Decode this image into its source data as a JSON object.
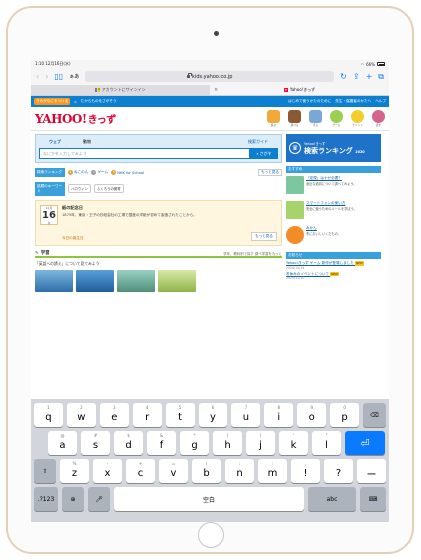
{
  "status_bar": {
    "left": "1:10  12月16日(水)",
    "right": "66%"
  },
  "browser": {
    "text_size_label": "ぁあ",
    "url": "kids.yahoo.co.jp",
    "tabs": [
      {
        "label": "アカウントにサインイン"
      },
      {
        "label": "Yahoo!きっず"
      }
    ]
  },
  "page": {
    "blue_bar": {
      "button": "きみがなにをつける",
      "links": [
        "たからものをさがそう"
      ],
      "right_links": [
        "はじめて使うかたのために",
        "先生・保護者のかたへ",
        "ヘルプ"
      ]
    },
    "logo": {
      "main": "YAHOO!",
      "sub": "きっず"
    },
    "header_icons": [
      {
        "label": "遊ぶ",
        "color": "#f2a93b"
      },
      {
        "label": "調べる",
        "color": "#8c5a32"
      },
      {
        "label": "学ぶ",
        "color": "#7aa6d8"
      },
      {
        "label": "ゲーム",
        "color": "#9bcf4f"
      },
      {
        "label": "チャット",
        "color": "#f3cf2e"
      },
      {
        "label": "話す",
        "color": "#d6638a"
      }
    ],
    "search": {
      "tabs": [
        "ウェブ",
        "動物"
      ],
      "parent_link": "検索ガイド",
      "placeholder": "なにかを入力してみよう",
      "submit": "さがす"
    },
    "ranking": {
      "label": "検索ランキング",
      "items": [
        {
          "num": "1",
          "text": "ねこのん"
        },
        {
          "num": "2",
          "text": "ゲーム"
        },
        {
          "num": "3",
          "text": "NHK for School"
        }
      ],
      "more": "もっと見る"
    },
    "keywords": {
      "label": "話題のキーワード",
      "items": [
        "ハロウィン",
        "ふくろうの飼育"
      ]
    },
    "today": {
      "month": "12月",
      "day": "16",
      "dow": "水",
      "title": "紙の記念日",
      "text": "1875年、東京・王子の抄紙会社の工場で国産の洋紙が初めて製造されたことから。",
      "birthday": "今日の誕生日",
      "more": "もっと見る"
    },
    "study": {
      "title": "学習",
      "sub": "学年、教科別で探す 調べ学習をもっと",
      "section_title": "「英語への誘え」について見てみよう"
    },
    "right": {
      "banner_small": "Yahoo!きっず",
      "banner_big": "検索ランキング",
      "banner_year": "2020",
      "section_label": "おすすめ",
      "items": [
        {
          "title": "「定規」はナゼ必要？",
          "text": "身近な道具について調べてみよう。",
          "color": "#7ec6a0"
        },
        {
          "title": "スマートフォンの使い方",
          "text": "安全に使うためのルールを学ぼう。",
          "color": "#a7d36b"
        },
        {
          "title": "みかん",
          "text": "冬においしいくだもの。",
          "color": "#f28c28"
        }
      ],
      "news_label": "お知らせ",
      "news": [
        {
          "text": "Yahoo!きっず ゲーム 新作が登場しました",
          "date": "2020/12/14"
        },
        {
          "text": "冬休みのイベントについて",
          "date": "2020/12/10"
        }
      ]
    }
  },
  "keyboard": {
    "row1": [
      {
        "main": "q",
        "sub": "1"
      },
      {
        "main": "w",
        "sub": "2"
      },
      {
        "main": "e",
        "sub": "3"
      },
      {
        "main": "r",
        "sub": "4"
      },
      {
        "main": "t",
        "sub": "5"
      },
      {
        "main": "y",
        "sub": "6"
      },
      {
        "main": "u",
        "sub": "7"
      },
      {
        "main": "i",
        "sub": "8"
      },
      {
        "main": "o",
        "sub": "9"
      },
      {
        "main": "p",
        "sub": "0"
      }
    ],
    "row2": [
      {
        "main": "a",
        "sub": "@"
      },
      {
        "main": "s",
        "sub": "#"
      },
      {
        "main": "d",
        "sub": "$"
      },
      {
        "main": "f",
        "sub": "&"
      },
      {
        "main": "g",
        "sub": "*"
      },
      {
        "main": "h",
        "sub": "("
      },
      {
        "main": "j",
        "sub": ")"
      },
      {
        "main": "k",
        "sub": "'"
      },
      {
        "main": "l",
        "sub": "\""
      }
    ],
    "row3": [
      {
        "main": "z",
        "sub": "%"
      },
      {
        "main": "x",
        "sub": "-"
      },
      {
        "main": "c",
        "sub": "+"
      },
      {
        "main": "v",
        "sub": "="
      },
      {
        "main": "b",
        "sub": "/"
      },
      {
        "main": "n",
        "sub": ";"
      },
      {
        "main": "m",
        "sub": ":"
      },
      {
        "main": "!",
        "sub": ","
      },
      {
        "main": "?",
        "sub": "."
      }
    ],
    "dash": "ー",
    "num_key": ".?123",
    "space_label": "空白",
    "abc_label": "abc"
  }
}
